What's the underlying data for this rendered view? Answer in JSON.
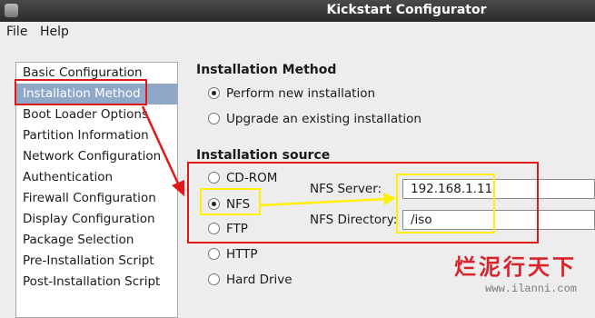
{
  "window": {
    "title": "Kickstart Configurator"
  },
  "menubar": {
    "items": [
      "File",
      "Help"
    ]
  },
  "sidebar": {
    "items": [
      "Basic Configuration",
      "Installation Method",
      "Boot Loader Options",
      "Partition Information",
      "Network Configuration",
      "Authentication",
      "Firewall Configuration",
      "Display Configuration",
      "Package Selection",
      "Pre-Installation Script",
      "Post-Installation Script"
    ],
    "selected_index": 1
  },
  "installation_method": {
    "heading": "Installation Method",
    "options": [
      "Perform new installation",
      "Upgrade an existing installation"
    ],
    "selected_index": 0
  },
  "installation_source": {
    "heading": "Installation source",
    "options": [
      "CD-ROM",
      "NFS",
      "FTP",
      "HTTP",
      "Hard Drive"
    ],
    "selected_index": 1,
    "nfs_server_label": "NFS Server:",
    "nfs_server_value": "192.168.1.11",
    "nfs_directory_label": "NFS Directory:",
    "nfs_directory_value": "/iso"
  },
  "watermark": {
    "text": "烂泥行天下",
    "url": "www.ilanni.com"
  },
  "colors": {
    "annotation_red": "#e01818",
    "annotation_yellow": "#ffef00",
    "selection": "#8fa8c8"
  }
}
